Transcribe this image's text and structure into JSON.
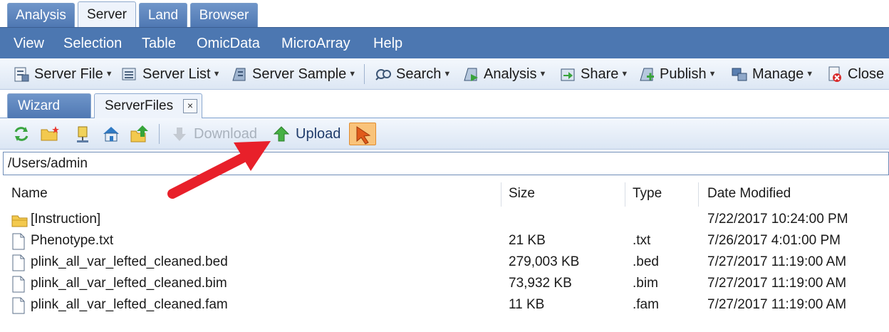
{
  "top_tabs": [
    "Analysis",
    "Server",
    "Land",
    "Browser"
  ],
  "active_top_tab": "Server",
  "menu": [
    "View",
    "Selection",
    "Table",
    "OmicData",
    "MicroArray",
    "Help"
  ],
  "toolbar": {
    "items": [
      {
        "label": "Server File",
        "icon": "server-file-icon"
      },
      {
        "label": "Server List",
        "icon": "server-list-icon"
      },
      {
        "label": "Server Sample",
        "icon": "server-sample-icon"
      },
      {
        "label": "Search",
        "icon": "search-icon"
      },
      {
        "label": "Analysis",
        "icon": "analysis-icon"
      },
      {
        "label": "Share",
        "icon": "share-icon"
      },
      {
        "label": "Publish",
        "icon": "publish-icon"
      },
      {
        "label": "Manage",
        "icon": "manage-icon"
      },
      {
        "label": "Close",
        "icon": "close-icon"
      }
    ]
  },
  "doc_tabs": {
    "wizard": "Wizard",
    "server_files": "ServerFiles",
    "close": "×"
  },
  "file_toolbar": {
    "icons": [
      "refresh-icon",
      "new-folder-icon",
      "home-icon",
      "network-home-icon",
      "up-folder-icon"
    ],
    "download": "Download",
    "upload": "Upload"
  },
  "path": "/Users/admin",
  "columns": {
    "name": "Name",
    "size": "Size",
    "type": "Type",
    "date": "Date Modified"
  },
  "files": [
    {
      "name": "[Instruction]",
      "size": "",
      "type": "",
      "date": "7/22/2017 10:24:00 PM",
      "kind": "folder"
    },
    {
      "name": "Phenotype.txt",
      "size": "21 KB",
      "type": ".txt",
      "date": "7/26/2017 4:01:00 PM",
      "kind": "file"
    },
    {
      "name": "plink_all_var_lefted_cleaned.bed",
      "size": "279,003 KB",
      "type": ".bed",
      "date": "7/27/2017 11:19:00 AM",
      "kind": "file"
    },
    {
      "name": "plink_all_var_lefted_cleaned.bim",
      "size": "73,932 KB",
      "type": ".bim",
      "date": "7/27/2017 11:19:00 AM",
      "kind": "file"
    },
    {
      "name": "plink_all_var_lefted_cleaned.fam",
      "size": "11 KB",
      "type": ".fam",
      "date": "7/27/2017 11:19:00 AM",
      "kind": "file"
    }
  ],
  "colors": {
    "menu_bg": "#4c77b1",
    "arrow": "#e8202a",
    "upload_arrow": "#3fae3a"
  }
}
